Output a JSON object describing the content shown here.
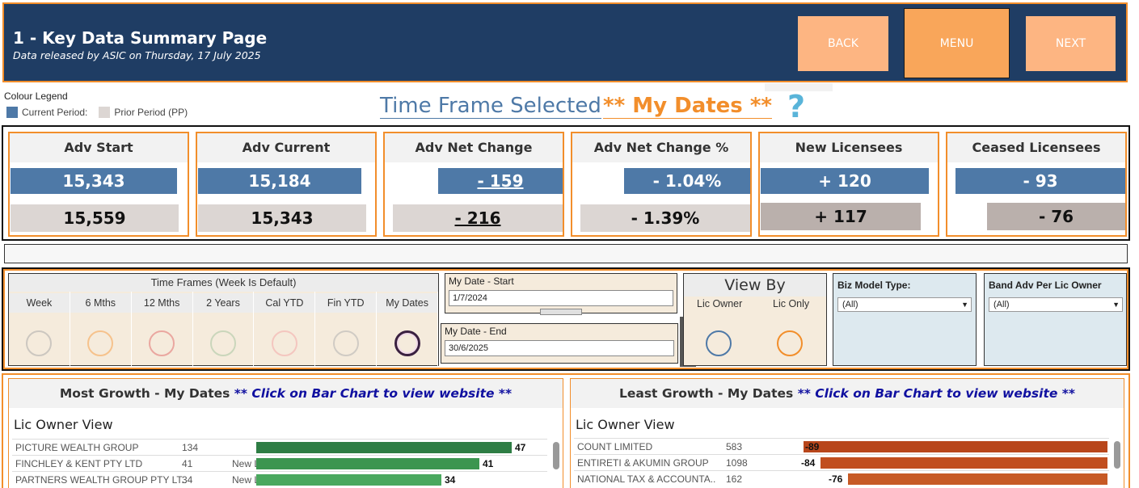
{
  "header": {
    "title": "1 - Key Data Summary Page",
    "subtitle": "Data released by ASIC on Thursday, 17 July 2025",
    "back": "BACK",
    "menu": "MENU",
    "next": "NEXT"
  },
  "legend": {
    "title": "Colour Legend",
    "current": "Current Period:",
    "prior": "Prior Period (PP)",
    "current_color": "#4e79a7",
    "prior_color": "#dcd6d3"
  },
  "timeframe": {
    "label": "Time Frame Selected",
    "value": "** My Dates **",
    "help": "?"
  },
  "kpis": [
    {
      "title": "Adv Start",
      "current": "15,343",
      "prior": "15,559"
    },
    {
      "title": "Adv Current",
      "current": "15,184",
      "prior": "15,343"
    },
    {
      "title": "Adv Net Change",
      "current": "- 159",
      "prior": "- 216"
    },
    {
      "title": "Adv Net Change %",
      "current": "- 1.04%",
      "prior": "- 1.39%"
    },
    {
      "title": "New Licensees",
      "current": "+ 120",
      "prior": "+ 117"
    },
    {
      "title": "Ceased Licensees",
      "current": "- 93",
      "prior": "- 76"
    }
  ],
  "filters": {
    "timeframes_title": "Time Frames (Week Is Default)",
    "timeframes": [
      {
        "label": "Week",
        "color": "#aaa9a9"
      },
      {
        "label": "6 Mths",
        "color": "#f5a04a"
      },
      {
        "label": "12 Mths",
        "color": "#e07070"
      },
      {
        "label": "2 Years",
        "color": "#a6c4a0"
      },
      {
        "label": "Cal YTD",
        "color": "#f2a8a8"
      },
      {
        "label": "Fin YTD",
        "color": "#b0b0b0"
      },
      {
        "label": "My Dates",
        "color": "#3a2040"
      }
    ],
    "date_start_label": "My Date - Start",
    "date_start": "1/7/2024",
    "date_end_label": "My Date - End",
    "date_end": "30/6/2025",
    "view_by_title": "View By",
    "view_by_owner": "Lic Owner",
    "view_by_only": "Lic Only",
    "biz_model_label": "Biz Model Type:",
    "biz_model_value": "(All)",
    "band_label": "Band Adv Per Lic Owner",
    "band_value": "(All)",
    "ctrl_close": "✕",
    "ctrl_pin": "⊥",
    "ctrl_down": "▾"
  },
  "most_growth": {
    "title": "Most Growth - My Dates",
    "hint": "** Click on Bar Chart to view website **",
    "view": "Lic Owner View",
    "rows": [
      {
        "name": "PICTURE WEALTH GROUP",
        "count": "134",
        "new": "",
        "value": 47,
        "label": "47",
        "color": "#2e7d44"
      },
      {
        "name": "FINCHLEY & KENT PTY LTD",
        "count": "41",
        "new": "New Lic",
        "value": 41,
        "label": "41",
        "color": "#3c9550"
      },
      {
        "name": "PARTNERS WEALTH GROUP PTY LT..",
        "count": "34",
        "new": "New Lic",
        "value": 34,
        "label": "34",
        "color": "#4aa85e"
      }
    ]
  },
  "least_growth": {
    "title": "Least Growth - My Dates",
    "hint": "** Click on Bar Chart to view website **",
    "view": "Lic Owner View",
    "rows": [
      {
        "name": "COUNT LIMITED",
        "count": "583",
        "value": -89,
        "label": "-89",
        "color": "#b8461b"
      },
      {
        "name": "ENTIRETI & AKUMIN GROUP",
        "count": "1098",
        "value": -84,
        "label": "-84",
        "color": "#c14e1f"
      },
      {
        "name": "NATIONAL TAX & ACCOUNTA..",
        "count": "162",
        "value": -76,
        "label": "-76",
        "color": "#c75a25"
      }
    ]
  }
}
